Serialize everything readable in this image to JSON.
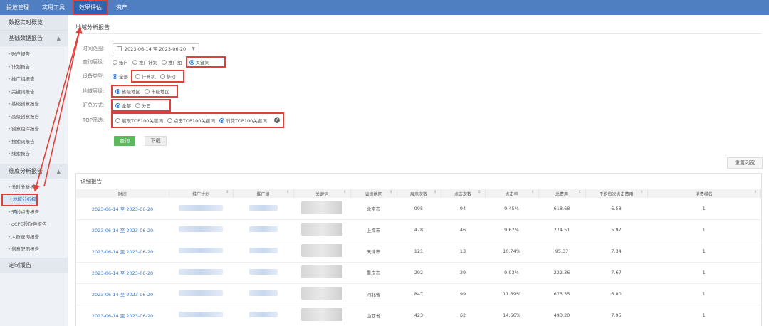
{
  "topnav": {
    "items": [
      {
        "label": "投放管理",
        "active": false
      },
      {
        "label": "实用工具",
        "active": false
      },
      {
        "label": "效果评估",
        "active": true
      },
      {
        "label": "资产",
        "active": false
      }
    ]
  },
  "sidebar": {
    "realtime": "数据实时概览",
    "basic_group": "基础数据报告",
    "basic_items": [
      "账户报告",
      "计划报告",
      "推广组报告",
      "关键词报告",
      "基础创意报告",
      "高级创意报告",
      "创意组件报告",
      "搜索词报告",
      "线索报告"
    ],
    "dimension_group": "维度分析报告",
    "dimension_items": [
      "分时分析报告",
      "地域分析报告",
      "无线点击报告",
      "oCPC投放包报告",
      "人群查询报告",
      "创意配图报告"
    ],
    "custom": "定制报告",
    "active_item": "地域分析报告"
  },
  "main": {
    "title": "地域分析报告",
    "filters": {
      "time_label": "时间范围:",
      "date_range": "2023-06-14 至 2023-06-20",
      "level_label": "查询层级:",
      "levels": [
        "账户",
        "推广计划",
        "推广组",
        "关键词"
      ],
      "level_checked": 3,
      "device_label": "设备类型:",
      "devices": [
        "全部",
        "计算机",
        "移动"
      ],
      "device_checked": 0,
      "region_label": "地域层级:",
      "regions": [
        "省级地区",
        "市级地区"
      ],
      "region_checked": 0,
      "summary_label": "汇总方式:",
      "summaries": [
        "全部",
        "分日"
      ],
      "summary_checked": 0,
      "top_label": "TOP筛选:",
      "tops": [
        "展现TOP100关键词",
        "点击TOP100关键词",
        "消费TOP100关键词"
      ],
      "top_checked": 2
    },
    "query_button": "查询",
    "download_button": "下载",
    "reset_columns_button": "重置列宽",
    "report_title": "详细报告",
    "columns": [
      "时间",
      "推广计划",
      "推广组",
      "关键词",
      "省级地区",
      "展示次数",
      "点击次数",
      "点击率",
      "总费用",
      "平均每次点击费用",
      "消费排名"
    ],
    "rows": [
      {
        "time": "2023-06-14 至 2023-06-20",
        "region": "北京市",
        "impressions": "995",
        "clicks": "94",
        "ctr": "9.45%",
        "cost": "618.68",
        "cpc": "6.58",
        "rank": "1"
      },
      {
        "time": "2023-06-14 至 2023-06-20",
        "region": "上海市",
        "impressions": "478",
        "clicks": "46",
        "ctr": "9.62%",
        "cost": "274.51",
        "cpc": "5.97",
        "rank": "1"
      },
      {
        "time": "2023-06-14 至 2023-06-20",
        "region": "天津市",
        "impressions": "121",
        "clicks": "13",
        "ctr": "10.74%",
        "cost": "95.37",
        "cpc": "7.34",
        "rank": "1"
      },
      {
        "time": "2023-06-14 至 2023-06-20",
        "region": "重庆市",
        "impressions": "292",
        "clicks": "29",
        "ctr": "9.93%",
        "cost": "222.36",
        "cpc": "7.67",
        "rank": "1"
      },
      {
        "time": "2023-06-14 至 2023-06-20",
        "region": "河北省",
        "impressions": "847",
        "clicks": "99",
        "ctr": "11.69%",
        "cost": "673.35",
        "cpc": "6.80",
        "rank": "1"
      },
      {
        "time": "2023-06-14 至 2023-06-20",
        "region": "山西省",
        "impressions": "423",
        "clicks": "62",
        "ctr": "14.66%",
        "cost": "493.20",
        "cpc": "7.95",
        "rank": "1"
      }
    ]
  },
  "colors": {
    "nav_bg": "#4f7ec1",
    "highlight_red": "#e0403a",
    "link_blue": "#3a78d0",
    "query_green": "#5cb85c"
  }
}
